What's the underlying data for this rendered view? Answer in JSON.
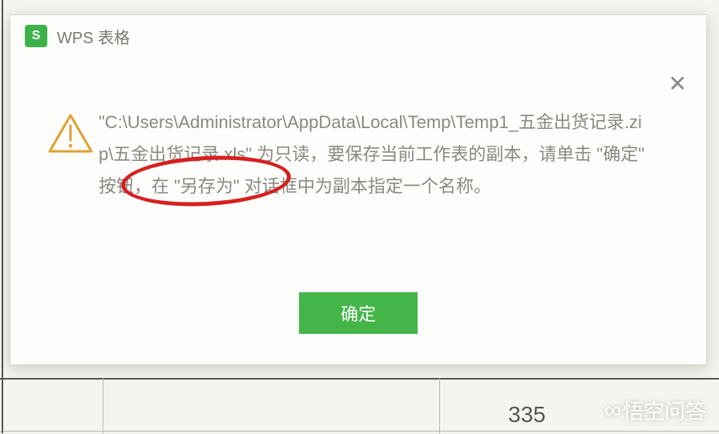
{
  "dialog": {
    "app_title": "WPS 表格",
    "close_glyph": "✕",
    "message": "\"C:\\Users\\Administrator\\AppData\\Local\\Temp\\Temp1_五金出货记录.zip\\五金出货记录.xls\" 为只读，要保存当前工作表的副本，请单击 \"确定\" 按钮，在 \"另存为\" 对话框中为副本指定一个名称。",
    "ok_label": "确定"
  },
  "background": {
    "visible_cell_value": "335"
  },
  "watermark": {
    "text": "悟空问答"
  },
  "colors": {
    "accent": "#44b549",
    "annotation_ring": "#d62020"
  }
}
